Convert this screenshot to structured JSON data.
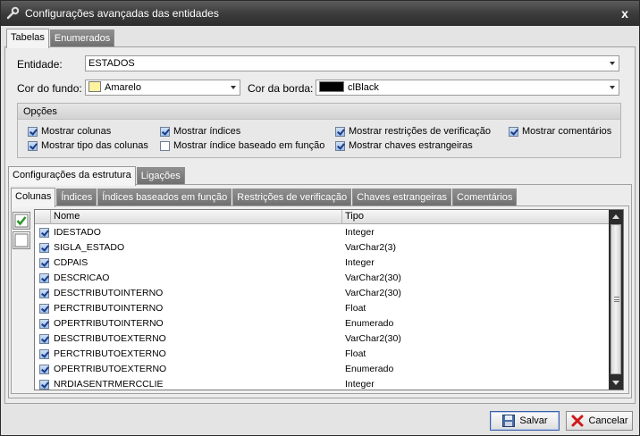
{
  "window": {
    "title": "Configurações avançadas das entidades",
    "close_glyph": "x"
  },
  "top_tabs": [
    {
      "label": "Tabelas",
      "active": true
    },
    {
      "label": "Enumerados",
      "active": false
    }
  ],
  "form": {
    "entidade_label": "Entidade:",
    "entidade_value": "ESTADOS",
    "cor_fundo_label": "Cor do fundo:",
    "cor_fundo_value": "Amarelo",
    "cor_fundo_color": "#fff3a0",
    "cor_borda_label": "Cor da borda:",
    "cor_borda_value": "clBlack",
    "cor_borda_color": "#000000"
  },
  "opcoes": {
    "title": "Opções",
    "items": [
      {
        "label": "Mostrar colunas",
        "checked": true
      },
      {
        "label": "Mostrar índices",
        "checked": true
      },
      {
        "label": "Mostrar restrições de verificação",
        "checked": true
      },
      {
        "label": "Mostrar comentários",
        "checked": true
      },
      {
        "label": "Mostrar tipo das colunas",
        "checked": true
      },
      {
        "label": "Mostrar índice baseado em função",
        "checked": false
      },
      {
        "label": "Mostrar chaves estrangeiras",
        "checked": true
      }
    ]
  },
  "struct_tabs": [
    {
      "label": "Configurações da estrutura",
      "active": true
    },
    {
      "label": "Ligações",
      "active": false
    }
  ],
  "inner_tabs": [
    {
      "label": "Colunas",
      "active": true
    },
    {
      "label": "Índices",
      "active": false
    },
    {
      "label": "Índices baseados em função",
      "active": false
    },
    {
      "label": "Restrições de verificação",
      "active": false
    },
    {
      "label": "Chaves estrangeiras",
      "active": false
    },
    {
      "label": "Comentários",
      "active": false
    }
  ],
  "grid": {
    "headers": [
      "Nome",
      "Tipo"
    ],
    "rows": [
      {
        "name": "IDESTADO",
        "type": "Integer"
      },
      {
        "name": "SIGLA_ESTADO",
        "type": "VarChar2(3)"
      },
      {
        "name": "CDPAIS",
        "type": "Integer"
      },
      {
        "name": "DESCRICAO",
        "type": "VarChar2(30)"
      },
      {
        "name": "DESCTRIBUTOINTERNO",
        "type": "VarChar2(30)"
      },
      {
        "name": "PERCTRIBUTOINTERNO",
        "type": "Float"
      },
      {
        "name": "OPERTRIBUTOINTERNO",
        "type": "Enumerado"
      },
      {
        "name": "DESCTRIBUTOEXTERNO",
        "type": "VarChar2(30)"
      },
      {
        "name": "PERCTRIBUTOEXTERNO",
        "type": "Float"
      },
      {
        "name": "OPERTRIBUTOEXTERNO",
        "type": "Enumerado"
      },
      {
        "name": "NRDIASENTRMERCCLIE",
        "type": "Integer"
      }
    ]
  },
  "buttons": {
    "save_label": "Salvar",
    "cancel_label": "Cancelar"
  }
}
